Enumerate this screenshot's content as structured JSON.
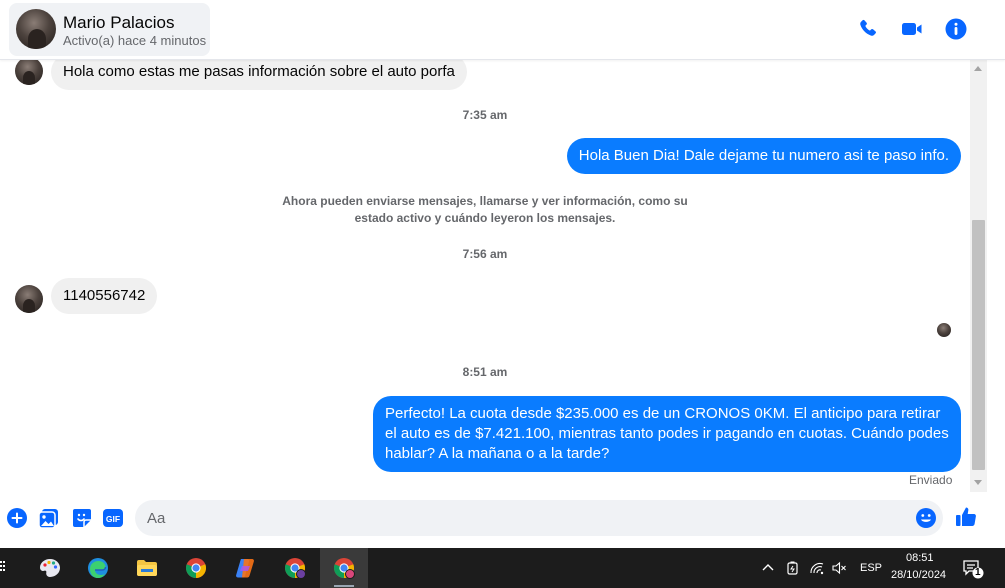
{
  "header": {
    "name": "Mario Palacios",
    "status": "Activo(a) hace 4 minutos"
  },
  "messages": {
    "in1": "Hola como estas me pasas información sobre el auto porfa",
    "time1": "7:35 am",
    "out1": "Hola Buen Dia! Dale dejame tu numero  asi te paso info.",
    "system": "Ahora pueden enviarse mensajes, llamarse y ver información, como su estado activo y cuándo leyeron los mensajes.",
    "time2": "7:56 am",
    "in2": "1140556742",
    "time3": "8:51 am",
    "out2": "Perfecto! La cuota desde $235.000 es de un CRONOS 0KM. El anticipo para retirar el auto es de $7.421.100, mientras tanto podes ir pagando en cuotas. Cuándo podes hablar? A la mañana o a la tarde?",
    "sent_status": "Enviado"
  },
  "composer": {
    "placeholder": "Aa"
  },
  "taskbar": {
    "language": "ESP",
    "time": "08:51",
    "date": "28/10/2024",
    "notifications": "1"
  },
  "colors": {
    "accent": "#0a7cff",
    "icon_blue": "#0866ff"
  },
  "icons": {
    "header": [
      "phone-icon",
      "video-icon",
      "info-icon"
    ],
    "composer": [
      "plus-icon",
      "gallery-icon",
      "sticker-icon",
      "gif-icon",
      "emoji-icon",
      "like-icon"
    ]
  }
}
